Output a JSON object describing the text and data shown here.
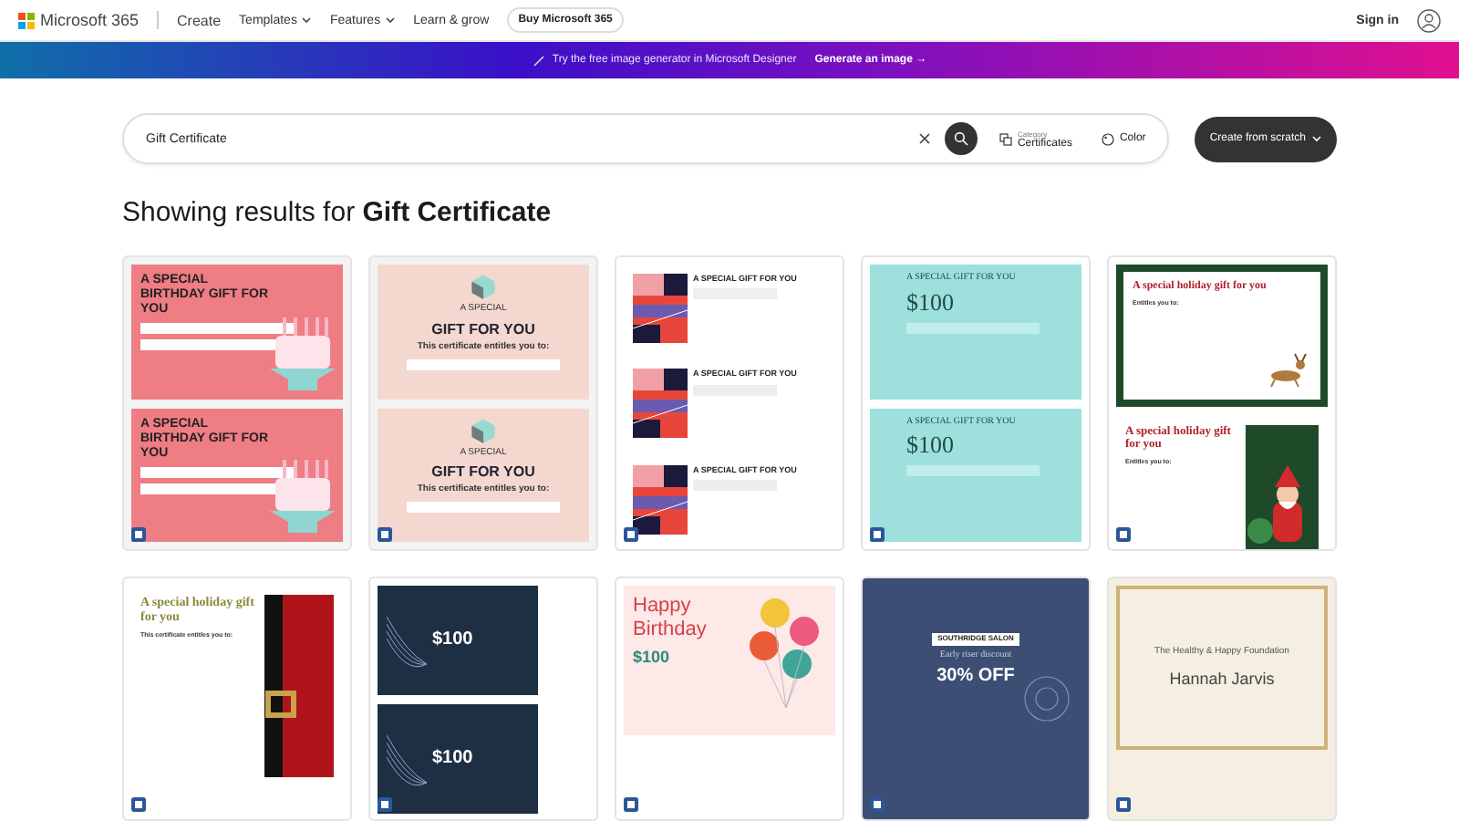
{
  "nav": {
    "logo": "Microsoft 365",
    "app": "Create",
    "menus": [
      {
        "label": "Templates",
        "dropdown": true
      },
      {
        "label": "Features",
        "dropdown": true
      },
      {
        "label": "Learn & grow",
        "dropdown": false
      }
    ],
    "buy": "Buy Microsoft 365",
    "sign_in": "Sign in"
  },
  "banner": {
    "text": "Try the free image generator in Microsoft Designer",
    "link": "Generate an image →"
  },
  "search": {
    "value": "Gift Certificate",
    "category_label": "Category",
    "category_value": "Certificates",
    "color_label": "Color",
    "create": "Create from scratch"
  },
  "heading": "Showing results for **Gift Certificate**",
  "results": [
    {
      "kind": "birthday",
      "panels": [
        {
          "title": "A SPECIAL BIRTHDAY GIFT FOR YOU"
        },
        {
          "title": "A SPECIAL BIRTHDAY GIFT FOR YOU"
        }
      ]
    },
    {
      "kind": "blocks",
      "panels": [
        {
          "subtitle": "A SPECIAL",
          "title": "GIFT FOR YOU",
          "note": "This certificate entitles you to:"
        },
        {
          "subtitle": "A SPECIAL",
          "title": "GIFT FOR YOU",
          "note": "This certificate entitles you to:"
        }
      ]
    },
    {
      "kind": "stripes",
      "panels": [
        {
          "title": "A SPECIAL GIFT FOR YOU"
        },
        {
          "title": "A SPECIAL GIFT FOR YOU"
        },
        {
          "title": "A SPECIAL GIFT FOR YOU"
        }
      ]
    },
    {
      "kind": "teal",
      "panels": [
        {
          "title": "A SPECIAL GIFT FOR YOU",
          "amount": "$100"
        },
        {
          "title": "A SPECIAL GIFT FOR YOU",
          "amount": "$100"
        }
      ]
    },
    {
      "kind": "holiday",
      "panels": [
        {
          "title": "A special holiday gift for you",
          "note": "Entitles you to:"
        },
        {
          "title": "A special holiday gift for you",
          "note": "Entitles you to:"
        }
      ]
    },
    {
      "kind": "belt",
      "panels": [
        {
          "title": "A special holiday gift for you",
          "note": "This certificate entitles you to:"
        }
      ]
    },
    {
      "kind": "navy",
      "panels": [
        {
          "amount": "$100"
        },
        {
          "amount": "$100"
        }
      ]
    },
    {
      "kind": "balloons",
      "panels": [
        {
          "title": "Happy Birthday",
          "amount": "$100"
        }
      ]
    },
    {
      "kind": "salon",
      "panels": [
        {
          "tag": "SOUTHRIDGE SALON",
          "subtitle": "Early riser discount",
          "amount": "30% OFF"
        }
      ]
    },
    {
      "kind": "foundation",
      "panels": [
        {
          "subtitle": "The Healthy & Happy Foundation",
          "title": "Hannah Jarvis"
        }
      ]
    }
  ]
}
